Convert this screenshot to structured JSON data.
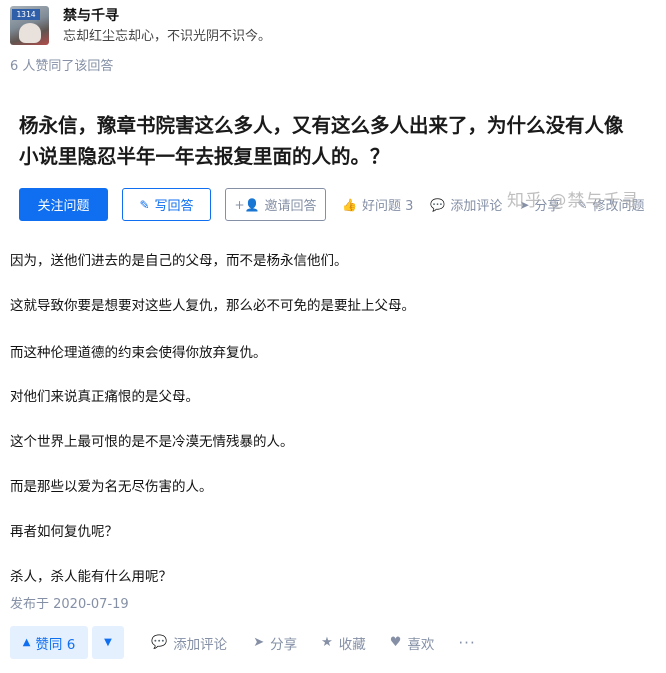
{
  "author": {
    "avatar_tag": "1314",
    "name": "禁与千寻",
    "bio": "忘却红尘忘却心，不识光阴不识今。"
  },
  "voters_text": "6 人赞同了该回答",
  "question": {
    "title": "杨永信，豫章书院害这么多人，又有这么多人出来了，为什么没有人像小说里隐忍半年一年去报复里面的人的。？"
  },
  "question_bar": {
    "follow_label": "关注问题",
    "write_label": "写回答",
    "invite_label": "邀请回答",
    "good_question_label": "好问题 3",
    "comment_label": "添加评论",
    "share_label": "分享",
    "edit_label": "修改问题"
  },
  "watermark": "知乎 @禁与千寻",
  "answer": {
    "paragraphs": [
      "因为，送他们进去的是自己的父母，而不是杨永信他们。",
      "这就导致你要是想要对这些人复仇，那么必不可免的是要扯上父母。",
      "而这种伦理道德的约束会使得你放弃复仇。",
      "对他们来说真正痛恨的是父母。",
      "这个世界上最可恨的是不是冷漠无情残暴的人。",
      "而是那些以爱为名无尽伤害的人。",
      "再者如何复仇呢？",
      "杀人，杀人能有什么用呢？"
    ],
    "published": "发布于 2020-07-19"
  },
  "answer_bar": {
    "upvote_label": "赞同 6",
    "comment_label": "添加评论",
    "share_label": "分享",
    "collect_label": "收藏",
    "like_label": "喜欢",
    "more_label": "···"
  },
  "colors": {
    "brand_blue": "#0f6ff0",
    "muted": "#8590a6",
    "vote_bg": "#e5f0ff"
  }
}
